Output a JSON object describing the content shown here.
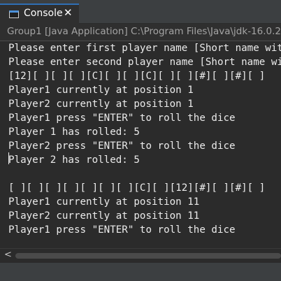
{
  "tab": {
    "label": "Console",
    "close_glyph": "✕",
    "icon": "console-icon"
  },
  "path_label": "Group1 [Java Application] C:\\Program Files\\Java\\jdk-16.0.2\\bin\\javaw.exe",
  "console_lines": [
    "Please enter first player name [Short name wit",
    "Please enter second player name [Short name wi",
    "[12][ ][ ][ ][C][ ][ ][C][ ][ ][#][ ][#][ ]",
    "Player1 currently at position 1",
    "Player2 currently at position 1",
    "Player1 press \"ENTER\" to roll the dice",
    "Player 1 has rolled: 5",
    "Player2 press \"ENTER\" to roll the dice",
    "Player 2 has rolled: 5",
    "",
    "[ ][ ][ ][ ][ ][ ][ ][C][ ][12][#][ ][#][ ]",
    "Player1 currently at position 11",
    "Player2 currently at position 11",
    "Player1 press \"ENTER\" to roll the dice"
  ],
  "scroll_left_glyph": "<",
  "colors": {
    "tab_accent": "#2f6fb5",
    "console_bg": "#2b2b2b",
    "console_text": "#ebebeb",
    "chrome_bg": "#3c3f41"
  }
}
